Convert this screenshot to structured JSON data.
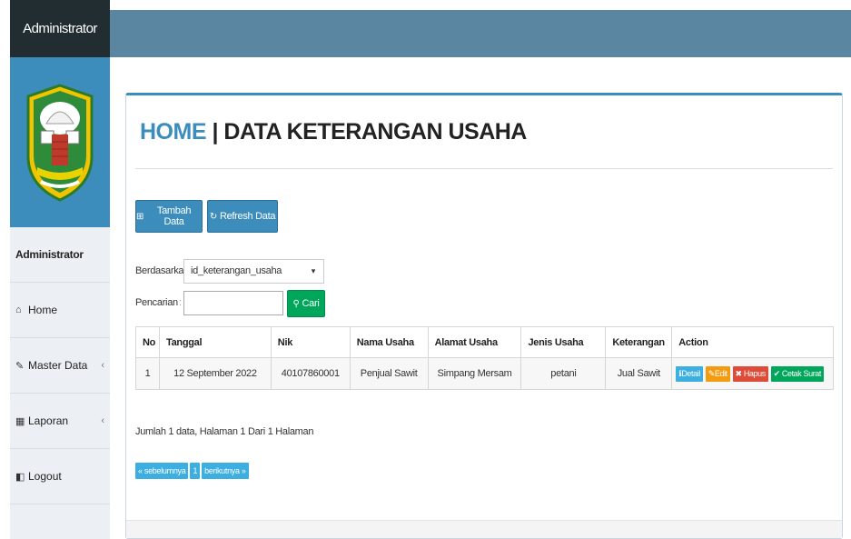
{
  "sidebar": {
    "brand": "Administrator",
    "user": "Administrator",
    "items": [
      {
        "label": "Home",
        "icon": "home-icon",
        "glyph": "⌂"
      },
      {
        "label": "Master Data",
        "icon": "edit-icon",
        "glyph": "✎"
      },
      {
        "label": "Laporan",
        "icon": "calendar-icon",
        "glyph": "▦"
      },
      {
        "label": "Logout",
        "icon": "logout-icon",
        "glyph": "◧"
      }
    ]
  },
  "page": {
    "title_highlight": "HOME",
    "title_separator": " | ",
    "title_rest": "DATA KETERANGAN USAHA"
  },
  "toolbar": {
    "add_label": "Tambah Data",
    "refresh_label": "Refresh Data"
  },
  "filter": {
    "by_label": "Berdasarkan:",
    "by_value": "id_keterangan_usaha",
    "search_label": "Pencarian",
    "search_button": "Cari"
  },
  "table": {
    "headers": [
      "No",
      "Tanggal",
      "Nik",
      "Nama Usaha",
      "Alamat Usaha",
      "Jenis Usaha",
      "Keterangan",
      "Action"
    ],
    "rows": [
      {
        "no": "1",
        "tanggal": "12 September 2022",
        "nik": "40107860001",
        "nama_usaha": "Penjual Sawit",
        "alamat_usaha": "Simpang Mersam",
        "jenis_usaha": "petani",
        "keterangan": "Jual Sawit"
      }
    ],
    "actions": {
      "detail": "Detail",
      "edit": "Edit",
      "hapus": "Hapus",
      "cetak": "Cetak Surat"
    }
  },
  "summary": "Jumlah 1 data, Halaman 1 Dari 1 Halaman",
  "pagination": {
    "prev": "« sebelumnya",
    "page": "1",
    "next": "berikutnya »"
  },
  "colors": {
    "primary": "#3c8dbc",
    "success": "#00a65a",
    "warning": "#f39c12",
    "danger": "#dd4b39",
    "info": "#3caee0",
    "topbar": "#5b86a2",
    "sidebar_dark": "#222d32"
  }
}
